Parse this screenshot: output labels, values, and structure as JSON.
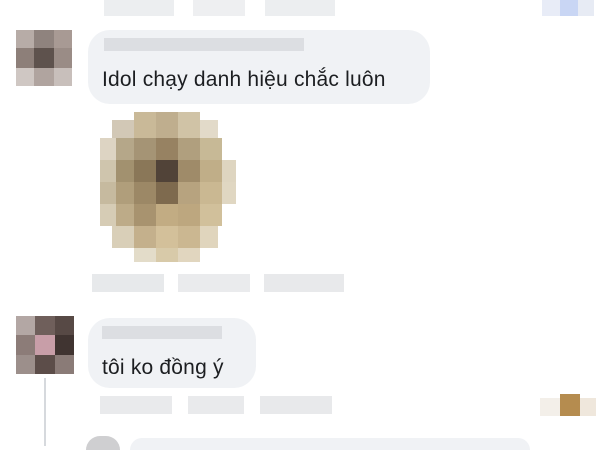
{
  "comments": [
    {
      "author": "",
      "text": "Idol chạy danh hiệu chắc luôn",
      "has_sticker": true
    },
    {
      "author": "",
      "text": "tôi ko đồng ý",
      "has_sticker": false
    }
  ],
  "colors": {
    "bubble": "#f0f2f5",
    "text": "#1c1e21",
    "pixelated_gray": "#e9eaec"
  },
  "icons": [
    "avatar-pixelated",
    "sticker-pixelated",
    "reaction-pixelated"
  ]
}
